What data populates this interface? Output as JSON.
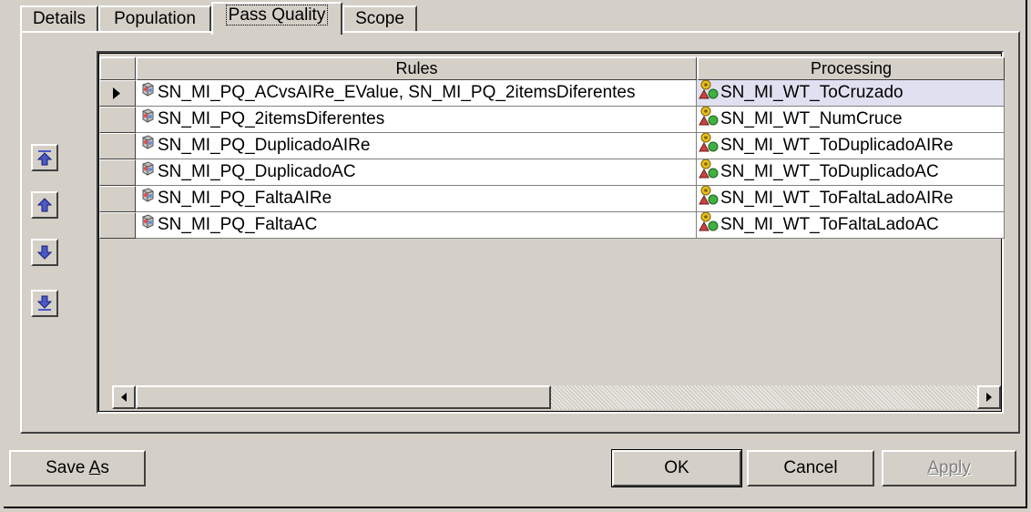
{
  "tabs": [
    {
      "label": "Details",
      "active": false
    },
    {
      "label": "Population",
      "active": false
    },
    {
      "label": "Pass Quality",
      "active": true
    },
    {
      "label": "Scope",
      "active": false
    }
  ],
  "grid": {
    "headers": {
      "rules": "Rules",
      "processing": "Processing"
    },
    "rows": [
      {
        "rules": "SN_MI_PQ_ACvsAIRe_EValue, SN_MI_PQ_2itemsDiferentes",
        "processing": "SN_MI_WT_ToCruzado",
        "selected": true
      },
      {
        "rules": "SN_MI_PQ_2itemsDiferentes",
        "processing": "SN_MI_WT_NumCruce",
        "selected": false
      },
      {
        "rules": "SN_MI_PQ_DuplicadoAIRe",
        "processing": "SN_MI_WT_ToDuplicadoAIRe",
        "selected": false
      },
      {
        "rules": "SN_MI_PQ_DuplicadoAC",
        "processing": "SN_MI_WT_ToDuplicadoAC",
        "selected": false
      },
      {
        "rules": "SN_MI_PQ_FaltaAIRe",
        "processing": "SN_MI_WT_ToFaltaLadoAIRe",
        "selected": false
      },
      {
        "rules": "SN_MI_PQ_FaltaAC",
        "processing": "SN_MI_WT_ToFaltaLadoAC",
        "selected": false
      }
    ],
    "rule_icon": "rule-cube-icon",
    "process_icon": "process-gears-icon"
  },
  "side_buttons": [
    "move-to-top-icon",
    "move-up-icon",
    "move-down-icon",
    "move-to-bottom-icon"
  ],
  "buttons": {
    "save_as_prefix": "Save ",
    "save_as_hotkey": "A",
    "save_as_suffix": "s",
    "ok": "OK",
    "cancel": "Cancel",
    "apply": "Apply"
  },
  "colors": {
    "face": "#d4d0c8",
    "selected_row": "#e0e0f0",
    "arrow_blue": "#4a58c8"
  }
}
